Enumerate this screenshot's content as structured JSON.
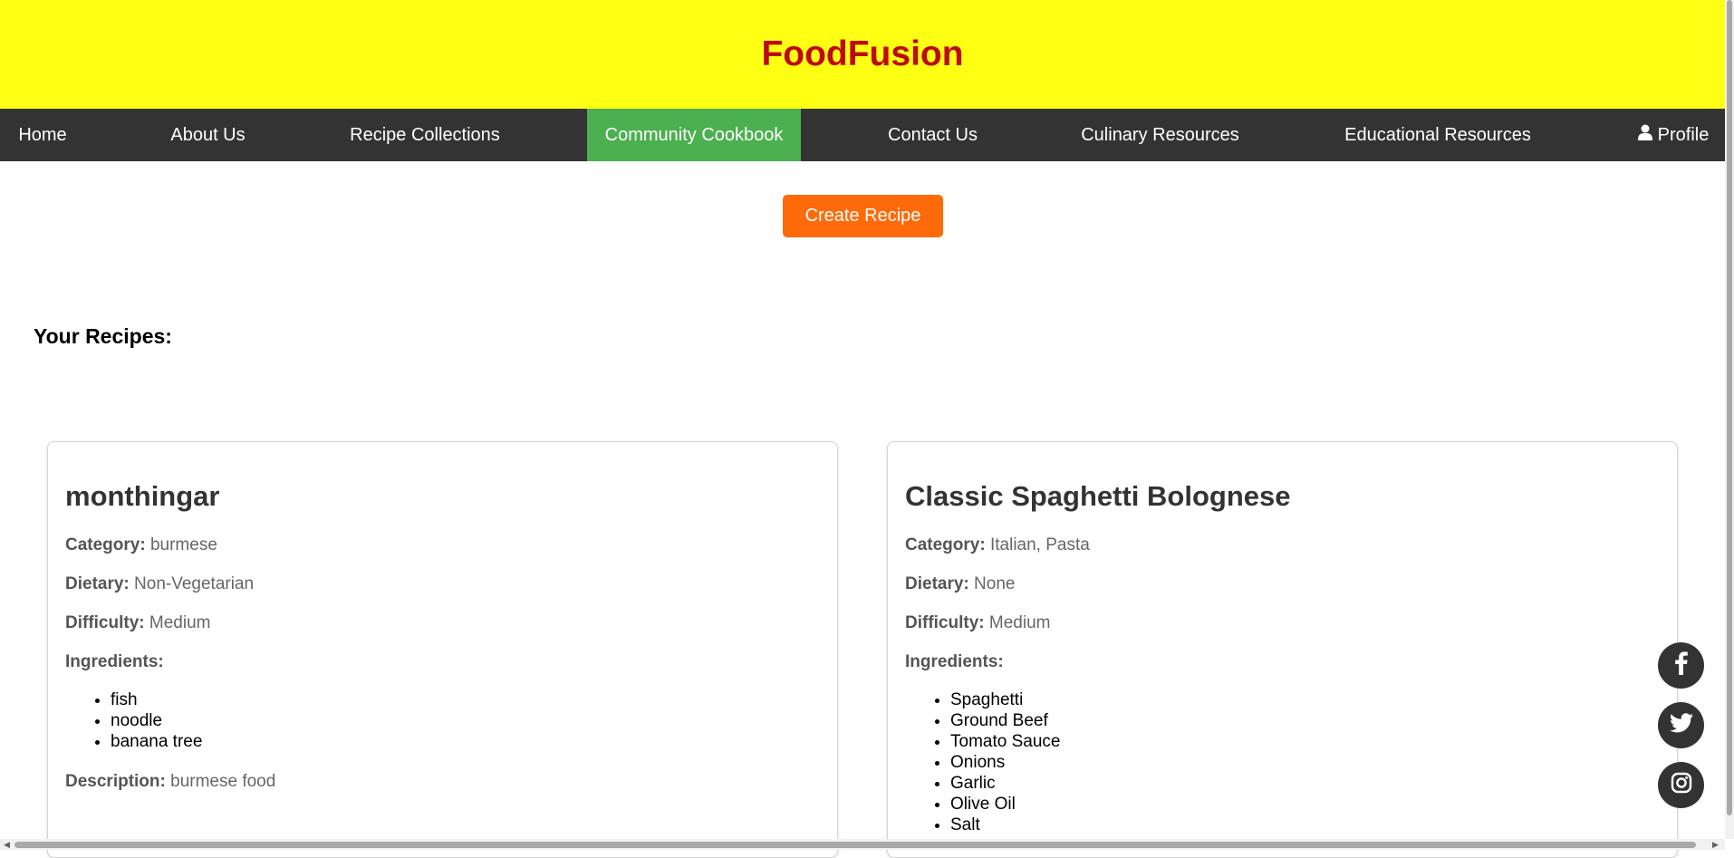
{
  "header": {
    "title": "FoodFusion"
  },
  "nav": {
    "items": [
      {
        "label": "Home"
      },
      {
        "label": "About Us"
      },
      {
        "label": "Recipe Collections"
      },
      {
        "label": "Community Cookbook",
        "active": true
      },
      {
        "label": "Contact Us"
      },
      {
        "label": "Culinary Resources"
      },
      {
        "label": "Educational Resources"
      },
      {
        "label": "Profile",
        "icon": "user-icon"
      }
    ]
  },
  "actions": {
    "create_label": "Create Recipe"
  },
  "section": {
    "heading": "Your Recipes:"
  },
  "labels": {
    "category": "Category:",
    "dietary": "Dietary:",
    "difficulty": "Difficulty:",
    "ingredients": "Ingredients:",
    "description": "Description:"
  },
  "recipes": [
    {
      "title": "monthingar",
      "category": "burmese",
      "dietary": "Non-Vegetarian",
      "difficulty": "Medium",
      "ingredients": [
        "fish",
        "noodle",
        "banana tree"
      ],
      "description": "burmese food"
    },
    {
      "title": "Classic Spaghetti Bolognese",
      "category": "Italian, Pasta",
      "dietary": "None",
      "difficulty": "Medium",
      "ingredients": [
        "Spaghetti",
        "Ground Beef",
        "Tomato Sauce",
        "Onions",
        "Garlic",
        "Olive Oil",
        "Salt"
      ]
    }
  ],
  "social": [
    "facebook-icon",
    "twitter-icon",
    "instagram-icon"
  ],
  "colors": {
    "header_bg": "#ffff14",
    "title": "#bd0a0a",
    "nav_bg": "#333333",
    "nav_active": "#4caf50",
    "button": "#ff6a0a"
  }
}
